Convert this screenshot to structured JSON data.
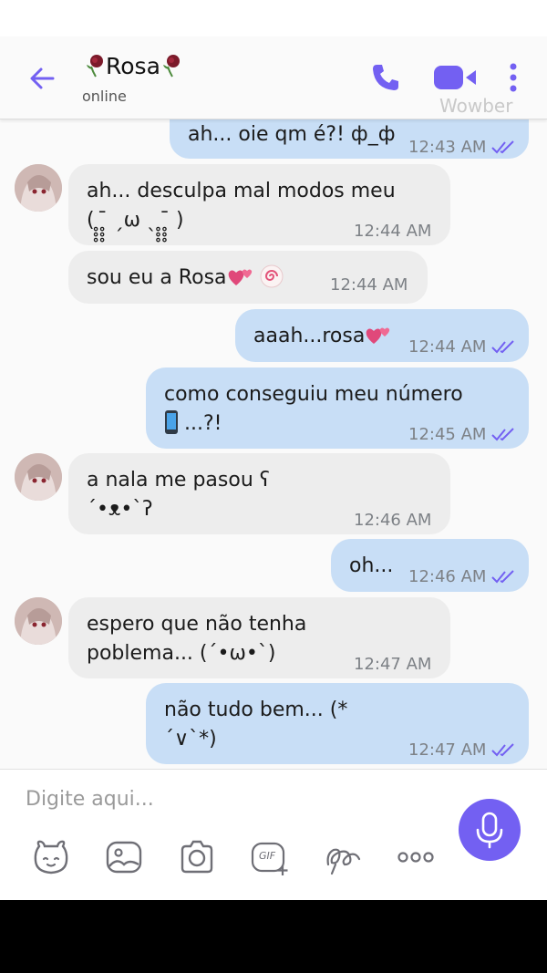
{
  "header": {
    "title": "Rosa",
    "subtitle": "online",
    "watermark": "Wowber"
  },
  "messages": [
    {
      "dir": "out",
      "lines": [
        "ah... oie qm é?! ф_ф"
      ],
      "time": "12:43 AM"
    },
    {
      "dir": "in",
      "lines": [
        "ah... desculpa mal modos meu",
        "( ̥̥̥ ̥̥̥̄ ˏω ˎ ̥̥̥ ̥̥̥̄ )"
      ],
      "time": "12:44 AM"
    },
    {
      "dir": "in",
      "lines": [
        "sou eu a Rosa"
      ],
      "time": "12:44 AM"
    },
    {
      "dir": "out",
      "lines": [
        "aaah...rosa"
      ],
      "time": "12:44 AM"
    },
    {
      "dir": "out",
      "lines": [
        "como conseguiu meu número",
        "...?!"
      ],
      "time": "12:45 AM"
    },
    {
      "dir": "in",
      "lines": [
        "a nala me pasou ʕ",
        "´•ᴥ•`ʔ"
      ],
      "time": "12:46 AM"
    },
    {
      "dir": "out",
      "lines": [
        "oh..."
      ],
      "time": "12:46 AM"
    },
    {
      "dir": "in",
      "lines": [
        "espero que não tenha",
        "poblema... (´•ω•`)"
      ],
      "time": "12:47 AM"
    },
    {
      "dir": "out",
      "lines": [
        "não tudo bem... (*",
        "´∨`*)"
      ],
      "time": "12:47 AM"
    }
  ],
  "composer": {
    "placeholder": "Digite aqui...",
    "gif_label": "GIF"
  },
  "icons": {
    "back": "arrow-left-icon",
    "call": "phone-icon",
    "video": "video-camera-icon",
    "more": "more-vertical-icon",
    "sticker": "bear-sticker-icon",
    "gallery": "image-icon",
    "camera": "camera-icon",
    "gif": "gif-icon",
    "doodle": "doodle-icon",
    "extras": "more-horizontal-icon",
    "mic": "microphone-icon"
  },
  "colors": {
    "accent": "#7360f2",
    "outgoing_bubble": "#c8def6",
    "incoming_bubble": "#ededed",
    "read_ticks": "#7360f2"
  }
}
